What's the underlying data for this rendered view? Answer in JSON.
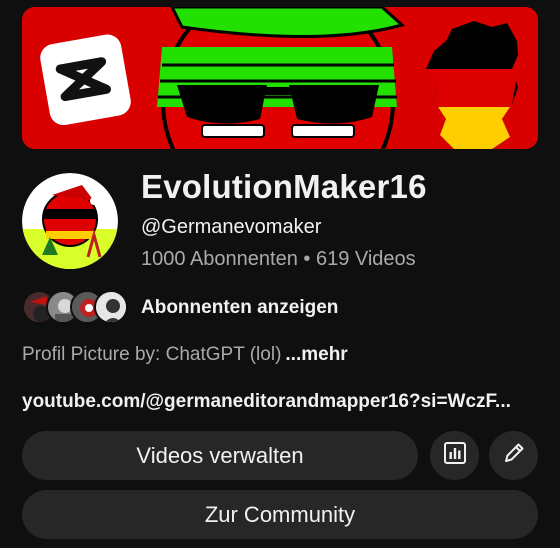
{
  "channel": {
    "name": "EvolutionMaker16",
    "handle": "@Germanevomaker",
    "stats": "1000 Abonnenten • 619 Videos"
  },
  "subscribers": {
    "label": "Abonnenten anzeigen"
  },
  "description": {
    "text": "Profil Picture by: ChatGPT (lol)",
    "more": "...mehr"
  },
  "link": {
    "text": "youtube.com/@germaneditorandmapper16?si=WczF..."
  },
  "buttons": {
    "manage_videos": "Videos verwalten",
    "community": "Zur Community",
    "stats_icon": "bar-chart-icon",
    "edit_icon": "pencil-icon"
  },
  "colors": {
    "background": "#0f0f0f",
    "button": "#272727",
    "text_primary": "#f1f1f1",
    "text_secondary": "#aaaaaa",
    "banner_red": "#d90000",
    "banner_green": "#22e000"
  }
}
